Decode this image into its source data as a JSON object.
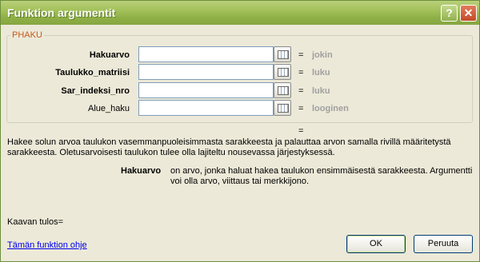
{
  "window": {
    "title": "Funktion argumentit"
  },
  "titlebar": {
    "help_glyph": "?",
    "close_glyph": "✕"
  },
  "group": {
    "legend": "PHAKU"
  },
  "arguments": [
    {
      "label": "Hakuarvo",
      "value": "",
      "result": "jokin",
      "bold": true
    },
    {
      "label": "Taulukko_matriisi",
      "value": "",
      "result": "luku",
      "bold": true
    },
    {
      "label": "Sar_indeksi_nro",
      "value": "",
      "result": "luku",
      "bold": true
    },
    {
      "label": "Alue_haku",
      "value": "",
      "result": "looginen",
      "bold": false
    }
  ],
  "equals": "=",
  "description": "Hakee solun arvoa taulukon vasemmanpuoleisimmasta sarakkeesta ja palauttaa arvon samalla rivillä määritetystä sarakkeesta. Oletusarvoisesti taulukon tulee olla lajiteltu nousevassa järjestyksessä.",
  "argument_help": {
    "name": "Hakuarvo",
    "text": "on arvo, jonka haluat hakea taulukon ensimmäisestä sarakkeesta. Argumentti voi olla arvo, viittaus tai merkkijono."
  },
  "formula_result": {
    "label": "Kaavan tulos="
  },
  "help_link": "Tämän funktion ohje",
  "buttons": {
    "ok": "OK",
    "cancel": "Peruuta"
  },
  "colors": {
    "title_bar": "#9bbb53",
    "legend": "#c65a1a",
    "hint": "#a0a0a0",
    "link": "#0000ee"
  }
}
